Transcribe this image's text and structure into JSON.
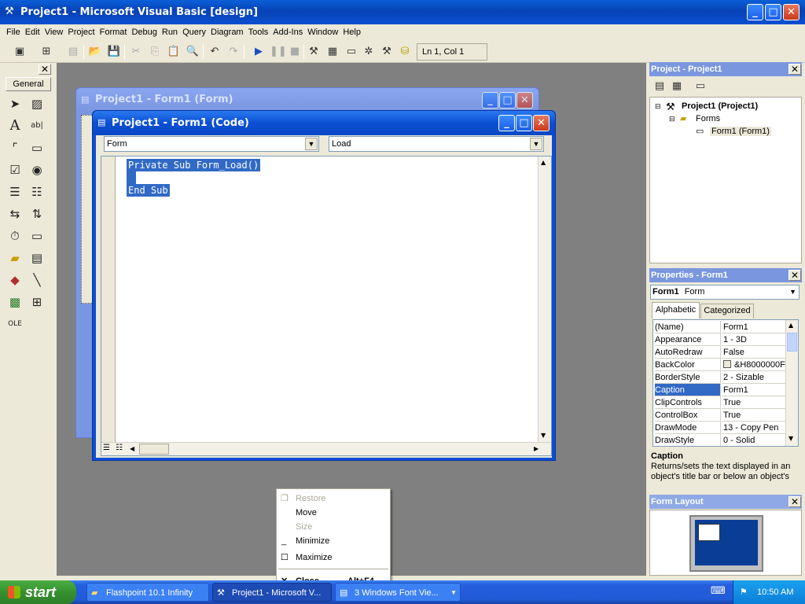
{
  "window": {
    "title": "Project1 - Microsoft Visual Basic [design]"
  },
  "menu": [
    "File",
    "Edit",
    "View",
    "Project",
    "Format",
    "Debug",
    "Run",
    "Query",
    "Diagram",
    "Tools",
    "Add-Ins",
    "Window",
    "Help"
  ],
  "toolbar": {
    "position": "Ln 1, Col 1"
  },
  "toolbox": {
    "tab": "General"
  },
  "form_window": {
    "title": "Project1 - Form1 (Form)"
  },
  "code_window": {
    "title": "Project1 - Form1 (Code)",
    "object_combo": "Form",
    "procedure_combo": "Load",
    "lines": [
      "Private Sub Form_Load()",
      "",
      "End Sub"
    ]
  },
  "project_panel": {
    "title": "Project - Project1",
    "tree": [
      "Project1 (Project1)",
      "Forms",
      "Form1 (Form1)"
    ]
  },
  "properties_panel": {
    "title": "Properties - Form1",
    "object_name": "Form1",
    "object_type": "Form",
    "tabs": [
      "Alphabetic",
      "Categorized"
    ],
    "rows": [
      {
        "name": "(Name)",
        "value": "Form1"
      },
      {
        "name": "Appearance",
        "value": "1 - 3D"
      },
      {
        "name": "AutoRedraw",
        "value": "False"
      },
      {
        "name": "BackColor",
        "value": "&H8000000F"
      },
      {
        "name": "BorderStyle",
        "value": "2 - Sizable"
      },
      {
        "name": "Caption",
        "value": "Form1"
      },
      {
        "name": "ClipControls",
        "value": "True"
      },
      {
        "name": "ControlBox",
        "value": "True"
      },
      {
        "name": "DrawMode",
        "value": "13 - Copy Pen"
      },
      {
        "name": "DrawStyle",
        "value": "0 - Solid"
      }
    ],
    "selected": "Caption",
    "desc_title": "Caption",
    "desc_text": "Returns/sets the text displayed in an object's title bar or below an object's"
  },
  "form_layout": {
    "title": "Form Layout"
  },
  "context_menu": {
    "items": [
      {
        "label": "Restore",
        "shortcut": "",
        "disabled": true
      },
      {
        "label": "Move",
        "shortcut": "",
        "disabled": false
      },
      {
        "label": "Size",
        "shortcut": "",
        "disabled": true
      },
      {
        "label": "Minimize",
        "shortcut": "",
        "disabled": false
      },
      {
        "label": "Maximize",
        "shortcut": "",
        "disabled": false
      },
      {
        "label": "Close",
        "shortcut": "Alt+F4",
        "disabled": false
      }
    ]
  },
  "taskbar": {
    "start": "start",
    "tasks": [
      "Flashpoint 10.1 Infinity",
      "Project1 - Microsoft V...",
      "3 Windows Font Vie..."
    ],
    "clock": "10:50 AM"
  },
  "colors": {
    "titlebar": "#0a4fd0",
    "selection": "#316ac5",
    "desktop": "#808080",
    "start": "#36912f"
  }
}
